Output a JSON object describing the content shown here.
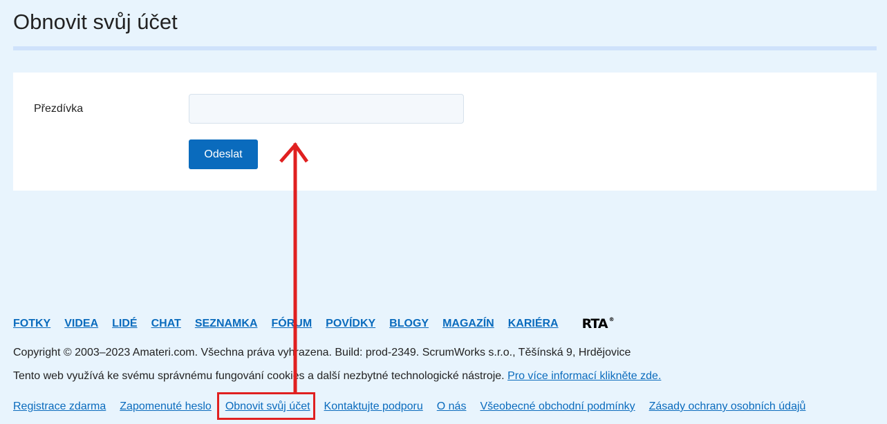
{
  "page": {
    "title": "Obnovit svůj účet"
  },
  "form": {
    "nickname_label": "Přezdívka",
    "nickname_value": "",
    "submit_label": "Odeslat"
  },
  "footer": {
    "nav": [
      "FOTKY",
      "VIDEA",
      "LIDÉ",
      "CHAT",
      "SEZNAMKA",
      "FÓRUM",
      "POVÍDKY",
      "BLOGY",
      "MAGAZÍN",
      "KARIÉRA"
    ],
    "logo_text": "RTA",
    "logo_mark": "®",
    "copyright": "Copyright © 2003–2023 Amateri.com. Všechna práva vyhrazena. Build: prod-2349. ScrumWorks s.r.o., Těšínská 9, Hrdějovice",
    "cookies_text": "Tento web využívá ke svému správnému fungování cookies a další nezbytné technologické nástroje.",
    "cookies_link": "Pro více informací klikněte zde.",
    "links": [
      "Registrace zdarma",
      "Zapomenuté heslo",
      "Obnovit svůj účet",
      "Kontaktujte podporu",
      "O nás",
      "Všeobecné obchodní podmínky",
      "Zásady ochrany osobních údajů"
    ]
  },
  "annotation": {
    "color": "#e02020"
  }
}
